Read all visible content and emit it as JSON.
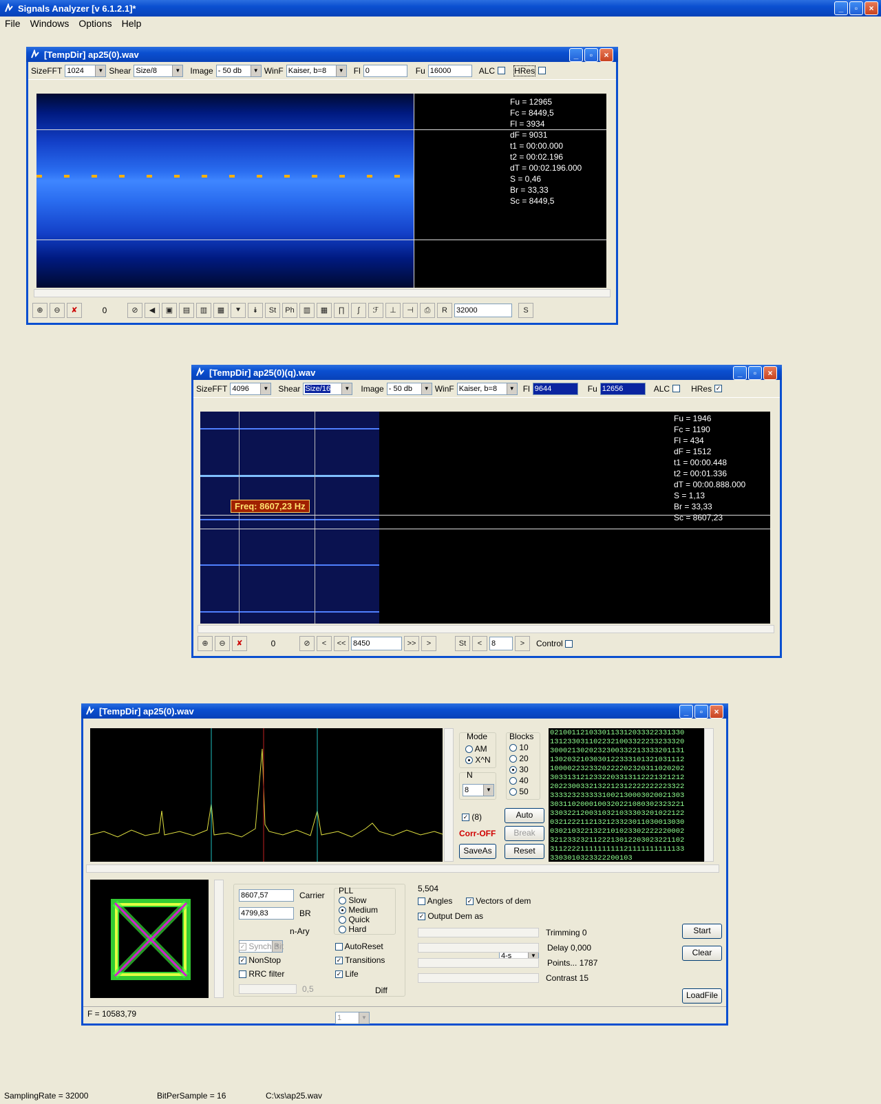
{
  "app": {
    "title": "Signals Analyzer [v 6.1.2.1]*",
    "menu": [
      "File",
      "Windows",
      "Options",
      "Help"
    ]
  },
  "win1": {
    "title": "[TempDir] ap25(0).wav",
    "toolbar": {
      "sizefft_label": "SizeFFT",
      "sizefft": "1024",
      "shear_label": "Shear",
      "shear": "Size/8",
      "image_label": "Image",
      "image": "- 50 db",
      "winf_label": "WinF",
      "winf": "Kaiser, b=8",
      "fl_label": "Fl",
      "fl": "0",
      "fu_label": "Fu",
      "fu": "16000",
      "alc": "ALC",
      "hres": "HRes"
    },
    "readout": [
      "Fu = 12965",
      "Fc = 8449,5",
      "Fl = 3934",
      "dF = 9031",
      "t1 = 00:00.000",
      "t2 = 00:02.196",
      "dT = 00:02.196.000",
      "S = 0,46",
      "Br = 33,33",
      "Sc = 8449,5"
    ],
    "bottom": {
      "counter": "0",
      "rate": "32000",
      "r": "R",
      "s": "S",
      "st": "St",
      "ph": "Ph"
    }
  },
  "win2": {
    "title": "[TempDir] ap25(0)(q).wav",
    "toolbar": {
      "sizefft_label": "SizeFFT",
      "sizefft": "4096",
      "shear_label": "Shear",
      "shear": "Size/16",
      "image_label": "Image",
      "image": "- 50 db",
      "winf_label": "WinF",
      "winf": "Kaiser, b=8",
      "fl_label": "Fl",
      "fl": "9644",
      "fu_label": "Fu",
      "fu": "12656",
      "alc": "ALC",
      "hres": "HRes"
    },
    "readout": [
      "Fu = 1946",
      "Fc = 1190",
      "Fl = 434",
      "dF = 1512",
      "t1 = 00:00.448",
      "t2 = 00:01.336",
      "dT = 00:00.888.000",
      "S = 1,13",
      "Br = 33,33",
      "Sc = 8607,23"
    ],
    "freq_tooltip": "Freq: 8607,23 Hz",
    "bottom": {
      "counter": "0",
      "lt": "<",
      "llt": "<<",
      "freq": "8450",
      "ggt": ">>",
      "gt": ">",
      "st": "St",
      "lt2": "<",
      "val": "8",
      "gt2": ">",
      "control": "Control"
    }
  },
  "win3": {
    "title": "[TempDir] ap25(0).wav",
    "mode": {
      "label": "Mode",
      "am": "AM",
      "xn": "X^N"
    },
    "n": {
      "label": "N",
      "value": "8"
    },
    "blocks": {
      "label": "Blocks",
      "options": [
        "10",
        "20",
        "30",
        "40",
        "50"
      ],
      "selected": "30"
    },
    "check8": "(8)",
    "corr": "Corr-OFF",
    "buttons": {
      "auto": "Auto",
      "break": "Break",
      "saveas": "SaveAs",
      "reset": "Reset",
      "start": "Start",
      "clear": "Clear",
      "loadfile": "LoadFile"
    },
    "symbols": [
      "0210011210330113312033322331330",
      "1312330311022321003322233233320",
      "3000213020232300332213333201131",
      "1302032103030122333101321031112",
      "1000022323320222202320311020202",
      "3033131212332203313112221321212",
      "2022300332132212312222222223322",
      "3333232333331002130003020021303",
      "3031102000100320221080302323221",
      "3303221200310321033303201022122",
      "0321222112132123323011030013030",
      "0302103221322101023302222220002",
      "3212332321122213012203023221102",
      "3112222111111111121111111111133",
      "3303010323322200103"
    ],
    "carrier_value": "8607,57",
    "carrier_label": "Carrier",
    "br_value": "4799,83",
    "br_label": "BR",
    "nary_value": "8",
    "nary_label": "n-Ary",
    "synch": "Synch Bit",
    "nonstop": "NonStop",
    "rrc": "RRC filter",
    "rrc_val": "0,5",
    "pll": {
      "label": "PLL",
      "options": [
        "Slow",
        "Medium",
        "Quick",
        "Hard"
      ],
      "selected": "Medium"
    },
    "autoreset": "AutoReset",
    "transitions": "Transitions",
    "life": "Life",
    "diff_val": "1",
    "diff": "Diff",
    "value_top": "5,504",
    "angles": "Angles",
    "vectors": "Vectors of dem",
    "output": "Output Dem as",
    "output_val": "4-s",
    "trimming": "Trimming 0",
    "delay": "Delay  0,000",
    "points": "Points... 1787",
    "contrast": "Contrast 15",
    "status": "F = 10583,79"
  },
  "statusbar": {
    "rate": "SamplingRate = 32000",
    "bps": "BitPerSample = 16",
    "file": "C:\\xs\\ap25.wav"
  },
  "colors": {
    "title": "#0a4fd0",
    "readout": "#ffffff",
    "symbols": "#90ff90",
    "trace": "#e0e040",
    "corr": "#d00000"
  }
}
